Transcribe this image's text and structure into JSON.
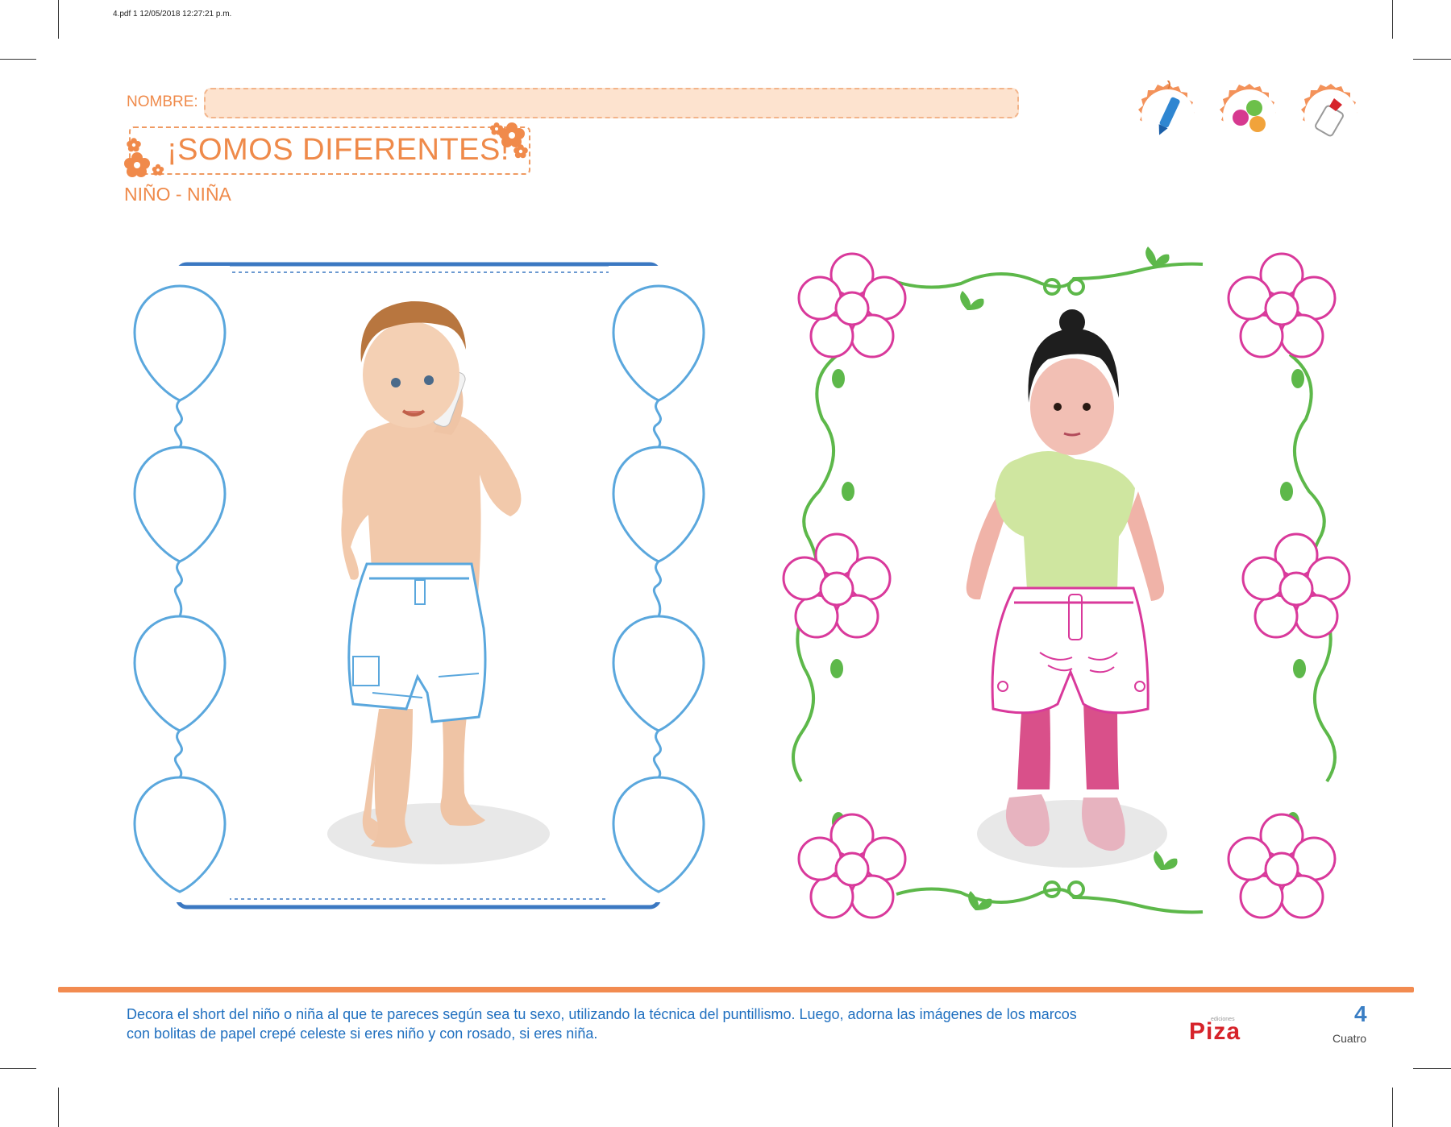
{
  "header": {
    "pdf_meta": "4.pdf   1   12/05/2018   12:27:21 p.m.",
    "name_label": "NOMBRE:",
    "title": "¡SOMOS DIFERENTES!",
    "subtitle": "NIÑO - NIÑA"
  },
  "tools": [
    {
      "icon": "marker-icon"
    },
    {
      "icon": "paper-balls-icon"
    },
    {
      "icon": "glue-icon"
    }
  ],
  "colors": {
    "accent_orange": "#ef8a4a",
    "boy_blue": "#5aa7dd",
    "girl_pink": "#d9399b",
    "vine_green": "#5db84a",
    "text_blue": "#1f6fbf"
  },
  "panels": {
    "boy": {
      "frame": "balloon-frame",
      "figure": "boy-on-phone"
    },
    "girl": {
      "frame": "flower-vine-frame",
      "figure": "girl-standing"
    }
  },
  "footer": {
    "instructions_line1": "Decora el short del niño o niña al que te pareces según sea tu sexo, utilizando la técnica del puntillismo. Luego, adorna las imágenes de los marcos",
    "instructions_line2": "con bolitas de papel crepé celeste si eres niño y con rosado, si eres niña.",
    "logo_small": "ediciones",
    "logo": "Piza",
    "page_number": "4",
    "page_word": "Cuatro"
  }
}
